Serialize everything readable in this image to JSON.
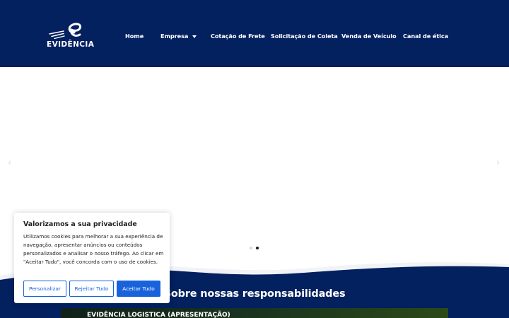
{
  "header": {
    "logo_text": "EVIDÊNCIA",
    "nav": [
      {
        "label": "Home"
      },
      {
        "label": "Empresa"
      },
      {
        "label": "Cotação de Frete"
      },
      {
        "label": "Solicitação de Coleta"
      },
      {
        "label": "Venda de Veículo"
      },
      {
        "label": "Canal de ética"
      }
    ]
  },
  "slider": {
    "prev_glyph": "‹",
    "next_glyph": "›",
    "active_slide": 2,
    "slide_count": 2
  },
  "section": {
    "title": "Sobre nossas responsabilidades",
    "video_title": "EVIDÊNCIA LOGISTICA (APRESENTAÇÃO)"
  },
  "cookie_banner": {
    "title": "Valorizamos a sua privacidade",
    "text": " Utilizamos cookies para melhorar a sua experiência de navegação, apresentar anúncios ou conteúdos personalizados e analisar o nosso tráfego. Ao clicar em \"Aceitar Tudo\", você concorda com o uso de cookies.",
    "customize_label": "Personalizar",
    "reject_label": "Rejeitar Tudo",
    "accept_label": "Aceitar Tudo"
  },
  "colors": {
    "brand_navy": "#03205f",
    "accent_blue": "#1863dc"
  }
}
